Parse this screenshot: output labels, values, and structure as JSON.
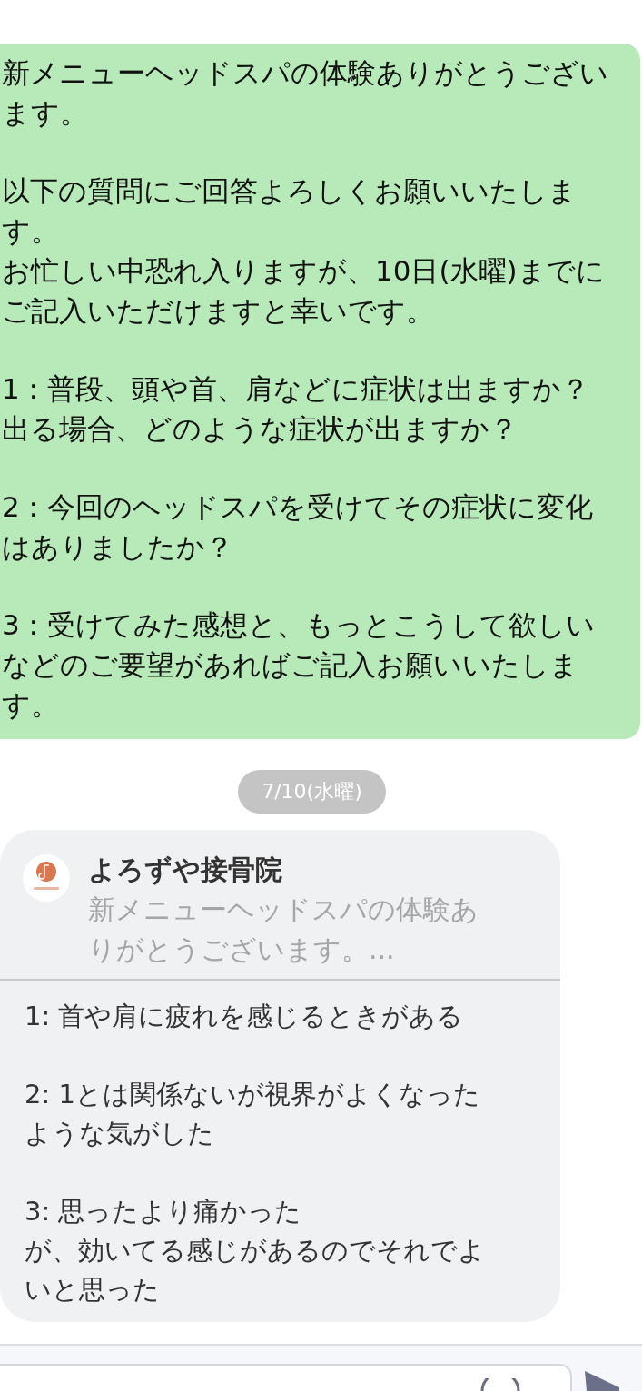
{
  "sent_message": {
    "paragraphs": [
      [
        "新メニューヘッドスパの体験ありがとうございます。"
      ],
      [
        "以下の質問にご回答よろしくお願いいたします。",
        "お忙しい中恐れ入りますが、10日(水曜)までにご記入いただけますと幸いです。"
      ],
      [
        "1 : 普段、頭や首、肩などに症状は出ますか？",
        "出る場合、どのような症状が出ますか？"
      ],
      [
        "2 : 今回のヘッドスパを受けてその症状に変化はありましたか？"
      ],
      [
        "3 : 受けてみた感想と、もっとこうして欲しいなどのご要望があればご記入お願いいたします。"
      ]
    ]
  },
  "date_chip": "7/10(水曜)",
  "reply_card": {
    "sender": "よろずや接骨院",
    "preview": "新メニューヘッドスパの体験ありがとうございます。...",
    "answers": [
      [
        "1: 首や肩に疲れを感じるときがある"
      ],
      [
        "2: 1とは関係ないが視界がよくなったような気がした"
      ],
      [
        "3: 思ったより痛かった",
        "が、効いてる感じがあるのでそれでよいと思った"
      ]
    ]
  }
}
